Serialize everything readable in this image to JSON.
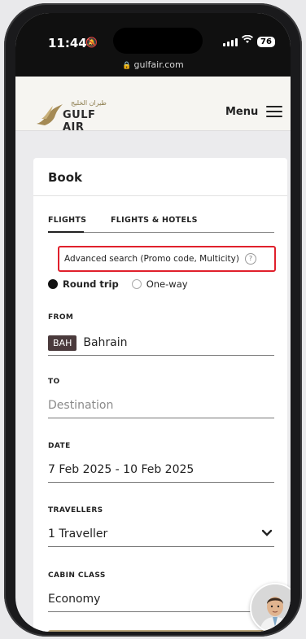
{
  "status_bar": {
    "time": "11:44",
    "battery": "76"
  },
  "url_bar": {
    "url": "gulfair.com"
  },
  "header": {
    "logo_arabic": "طيران الخليج",
    "logo_text": "GULF AIR",
    "menu_label": "Menu"
  },
  "book": {
    "title": "Book",
    "tabs": [
      "FLIGHTS",
      "FLIGHTS & HOTELS"
    ],
    "active_tab": "FLIGHTS",
    "advanced_search": "Advanced search (Promo code, Multicity)",
    "help_symbol": "?",
    "trip_types": [
      "Round trip",
      "One-way"
    ],
    "selected_trip": "Round trip",
    "from": {
      "label": "FROM",
      "code": "BAH",
      "city": "Bahrain"
    },
    "to": {
      "label": "TO",
      "placeholder": "Destination"
    },
    "date": {
      "label": "DATE",
      "value": "7 Feb 2025 - 10 Feb 2025"
    },
    "travellers": {
      "label": "TRAVELLERS",
      "value": "1 Traveller"
    },
    "cabin_class": {
      "label": "CABIN CLASS",
      "value": "Economy"
    }
  },
  "colors": {
    "brand_gold": "#b9a57a",
    "highlight_red": "#e0202c",
    "code_badge": "#4a3a3c"
  }
}
